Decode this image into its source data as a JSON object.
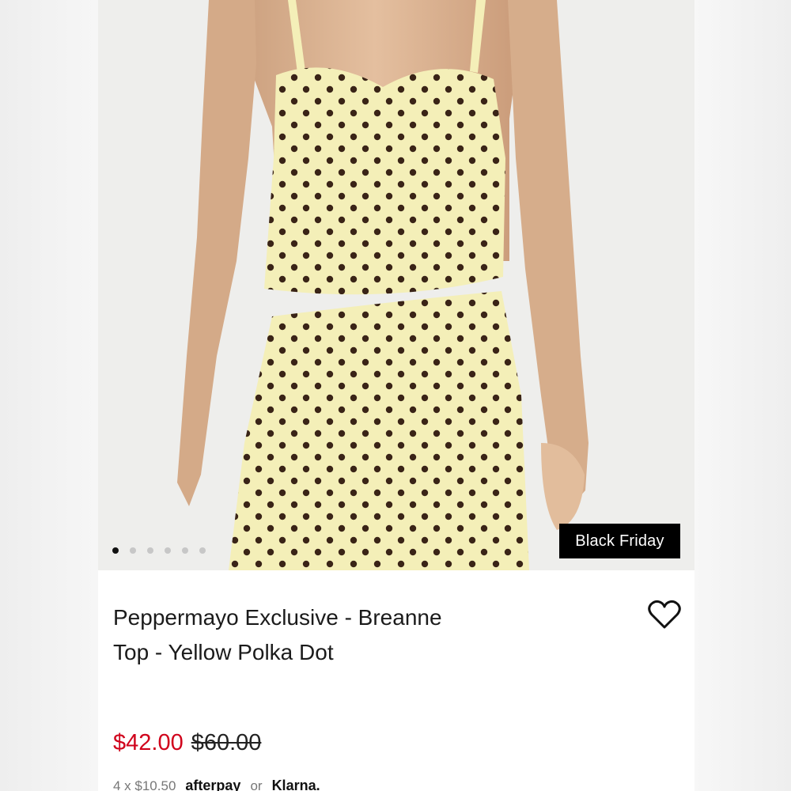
{
  "product": {
    "title": "Peppermayo Exclusive - Breanne Top - Yellow Polka Dot",
    "badge": "Black Friday",
    "sale_price": "$42.00",
    "original_price": "$60.00",
    "image_description_icon": "product-photo",
    "carousel": {
      "total": 6,
      "active": 0
    }
  },
  "payment": {
    "installment_text": "4 x $10.50",
    "provider_1": "afterpay",
    "separator": "or",
    "provider_2": "Klarna."
  },
  "colors": {
    "sale": "#d0021b",
    "garment": "#f4efb8",
    "dots": "#3a2417",
    "badge_bg": "#000000"
  }
}
